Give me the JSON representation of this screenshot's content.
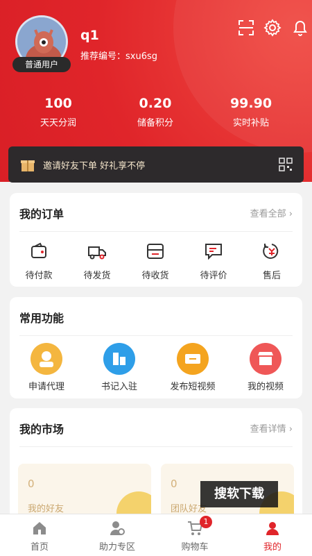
{
  "profile": {
    "name": "q1",
    "member_level": "普通用户",
    "ref_code": "推荐编号：sxu6sg"
  },
  "stats": [
    {
      "value": "100",
      "label": "天天分润"
    },
    {
      "value": "0.20",
      "label": "储备积分"
    },
    {
      "value": "99.90",
      "label": "实时补贴"
    }
  ],
  "invite": {
    "text": "邀请好友下单  好礼享不停"
  },
  "orders": {
    "title": "我的订单",
    "more": "查看全部",
    "items": [
      {
        "label": "待付款",
        "icon": "wallet-icon"
      },
      {
        "label": "待发货",
        "icon": "truck-icon"
      },
      {
        "label": "待收货",
        "icon": "inbox-icon"
      },
      {
        "label": "待评价",
        "icon": "comment-icon"
      },
      {
        "label": "售后",
        "icon": "refund-icon"
      }
    ]
  },
  "functions": {
    "title": "常用功能",
    "items": [
      {
        "label": "申请代理",
        "icon": "agent-icon",
        "color": "#f4b63f"
      },
      {
        "label": "书记入驻",
        "icon": "building-icon",
        "color": "#2e9ee8"
      },
      {
        "label": "发布短视频",
        "icon": "ticket-icon",
        "color": "#f4a41f"
      },
      {
        "label": "我的视频",
        "icon": "shop-icon",
        "color": "#ef5757"
      }
    ]
  },
  "market": {
    "title": "我的市场",
    "more": "查看详情",
    "boxes": [
      {
        "value": "0",
        "label": "我的好友"
      },
      {
        "value": "0",
        "label": "团队好友"
      }
    ]
  },
  "watermark": "搜软下载",
  "tabs": [
    {
      "label": "首页",
      "icon": "home-icon"
    },
    {
      "label": "助力专区",
      "icon": "user-assist-icon"
    },
    {
      "label": "购物车",
      "icon": "cart-icon",
      "badge": "1"
    },
    {
      "label": "我的",
      "icon": "profile-icon",
      "active": true
    }
  ],
  "colors": {
    "brand_red": "#e0252a",
    "invite_bg": "#2d2a2c"
  }
}
